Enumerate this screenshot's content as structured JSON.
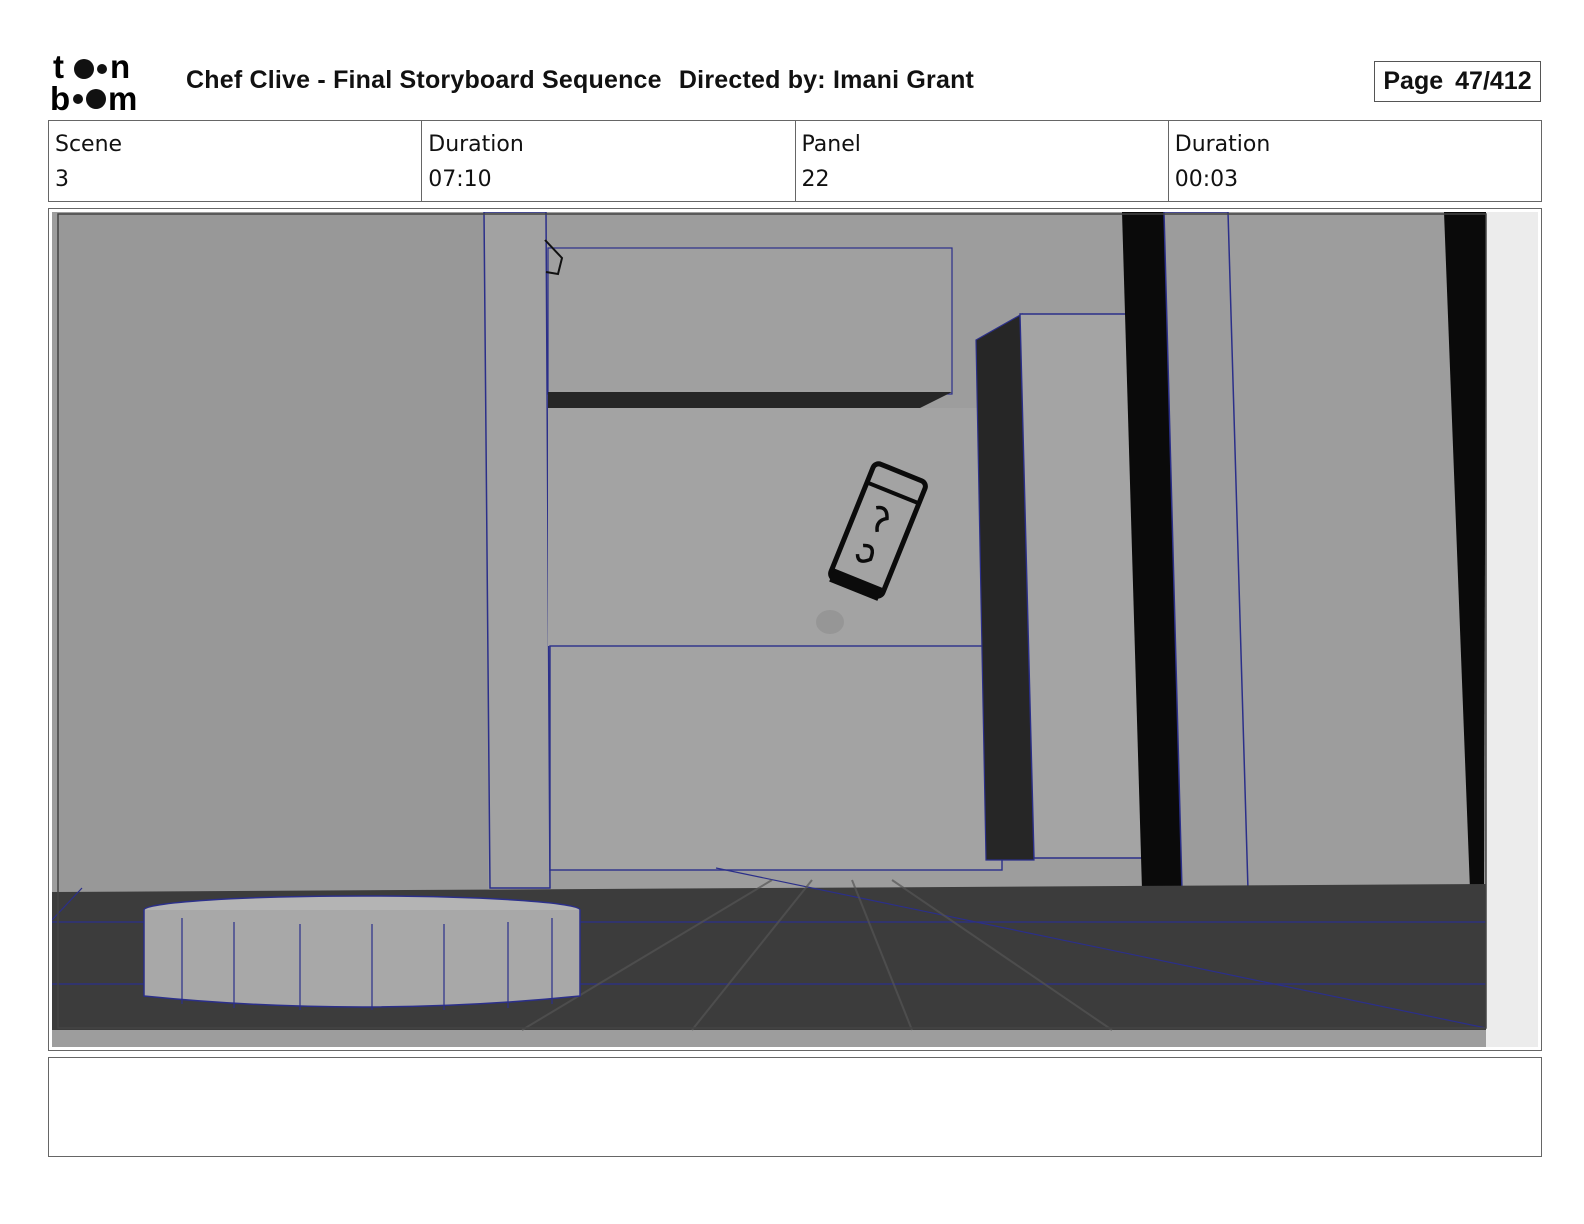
{
  "header": {
    "logo_text_top": "toon",
    "logo_text_bottom": "boom",
    "project_title": "Chef Clive - Final Storyboard Sequence",
    "director_label": "Directed by: Imani Grant",
    "page_label": "Page",
    "page_value": "47/412"
  },
  "info": [
    {
      "label": "Scene",
      "value": "3"
    },
    {
      "label": "Duration",
      "value": "07:10"
    },
    {
      "label": "Panel",
      "value": "22"
    },
    {
      "label": "Duration",
      "value": "00:03"
    }
  ],
  "notes": {
    "text": ""
  },
  "colors": {
    "line_blue": "#2b2f8a",
    "wall_grey": "#9a9a9a",
    "floor_dark": "#3f3f3f"
  }
}
